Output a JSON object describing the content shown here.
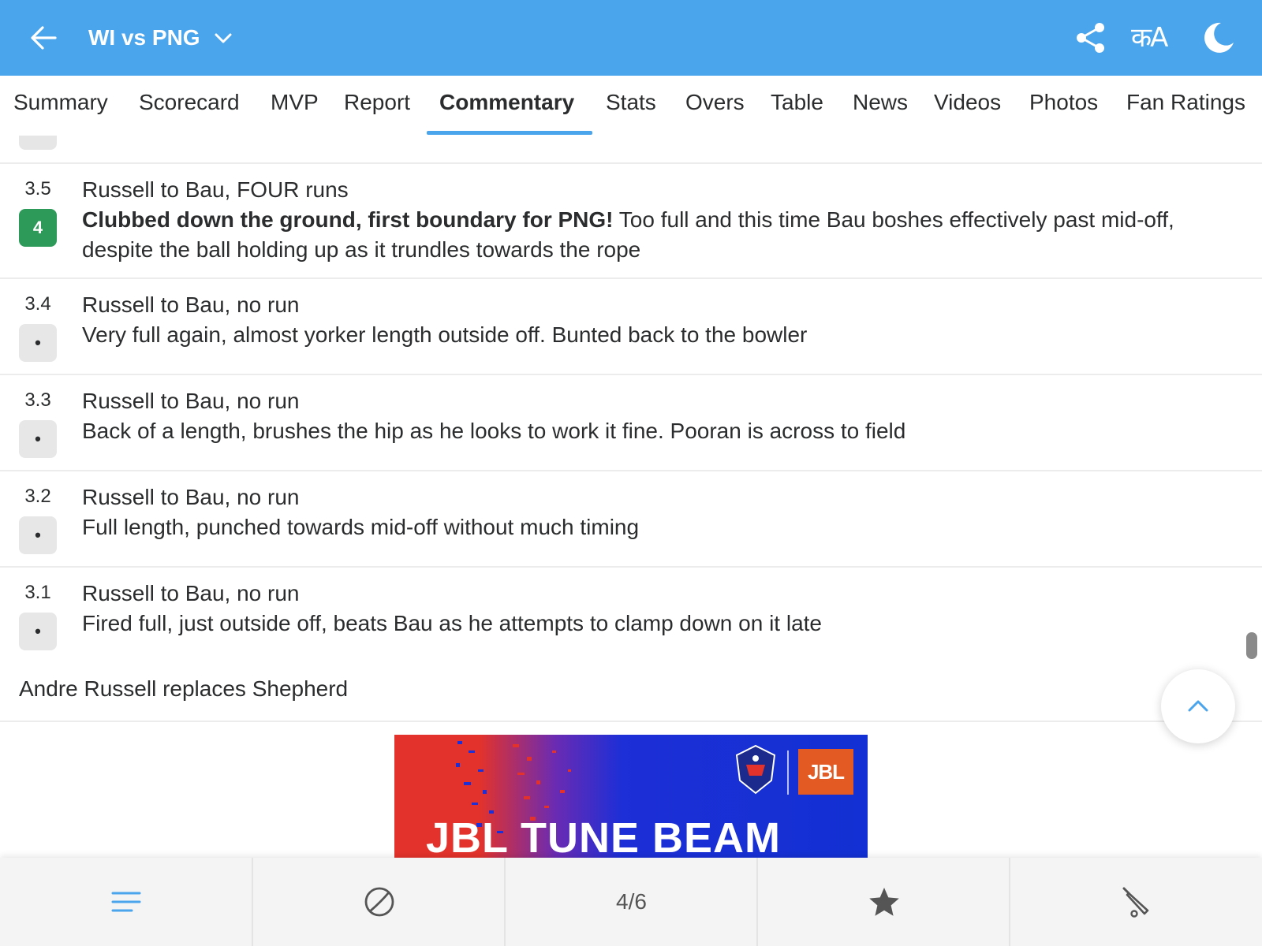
{
  "header": {
    "title": "WI vs PNG",
    "lang_label": "कA"
  },
  "tabs": [
    {
      "label": "Summary"
    },
    {
      "label": "Scorecard"
    },
    {
      "label": "MVP"
    },
    {
      "label": "Report"
    },
    {
      "label": "Commentary",
      "active": true
    },
    {
      "label": "Stats"
    },
    {
      "label": "Overs"
    },
    {
      "label": "Table"
    },
    {
      "label": "News"
    },
    {
      "label": "Videos"
    },
    {
      "label": "Photos"
    },
    {
      "label": "Fan Ratings"
    }
  ],
  "commentary": [
    {
      "over": "3.5",
      "badge": "4",
      "headline": "Russell to Bau, FOUR runs",
      "desc_bold": "Clubbed down the ground, first boundary for PNG!",
      "desc": " Too full and this time Bau boshes effectively past mid-off, despite the ball holding up as it trundles towards the rope"
    },
    {
      "over": "3.4",
      "badge": "•",
      "headline": "Russell to Bau, no run",
      "desc_bold": "",
      "desc": "Very full again, almost yorker length outside off. Bunted back to the bowler"
    },
    {
      "over": "3.3",
      "badge": "•",
      "headline": "Russell to Bau, no run",
      "desc_bold": "",
      "desc": "Back of a length, brushes the hip as he looks to work it fine. Pooran is across to field"
    },
    {
      "over": "3.2",
      "badge": "•",
      "headline": "Russell to Bau, no run",
      "desc_bold": "",
      "desc": "Full length, punched towards mid-off without much timing"
    },
    {
      "over": "3.1",
      "badge": "•",
      "headline": "Russell to Bau, no run",
      "desc_bold": "",
      "desc": "Fired full, just outside off, beats Bau as he attempts to clamp down on it late"
    }
  ],
  "note": "Andre Russell replaces Shepherd",
  "ad": {
    "brand": "JBL",
    "headline": "JBL TUNE BEAM"
  },
  "bottom_nav": {
    "page_indicator": "4/6",
    "icons": [
      "menu-icon",
      "ball-icon",
      "star-icon",
      "bat-icon"
    ]
  },
  "colors": {
    "primary": "#4aa5ec",
    "four_badge": "#2e9a5a"
  }
}
